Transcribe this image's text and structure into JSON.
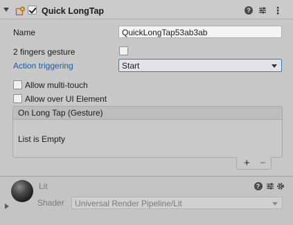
{
  "component": {
    "title": "Quick LongTap",
    "enabled": true,
    "icons": [
      "foldout-arrow-icon",
      "script-icon",
      "help-icon",
      "preset-icon",
      "kebab-menu-icon"
    ]
  },
  "fields": {
    "name_label": "Name",
    "name_value": "QuickLongTap53ab3ab",
    "two_fingers_label": "2 fingers gesture",
    "two_fingers_checked": false,
    "action_label": "Action triggering",
    "action_value": "Start",
    "multi_touch_label": "Allow multi-touch",
    "multi_touch_checked": false,
    "over_ui_label": "Allow over UI Element",
    "over_ui_checked": false
  },
  "event": {
    "header": "On Long Tap (Gesture)",
    "empty_text": "List is Empty",
    "add_label": "+",
    "remove_label": "−"
  },
  "material": {
    "name": "Lit",
    "shader_label": "Shader",
    "shader_value": "Universal Render Pipeline/Lit"
  },
  "colors": {
    "accent": "#3a79bf",
    "action_label": "#1d5a9e",
    "background": "#c8c8c8"
  }
}
